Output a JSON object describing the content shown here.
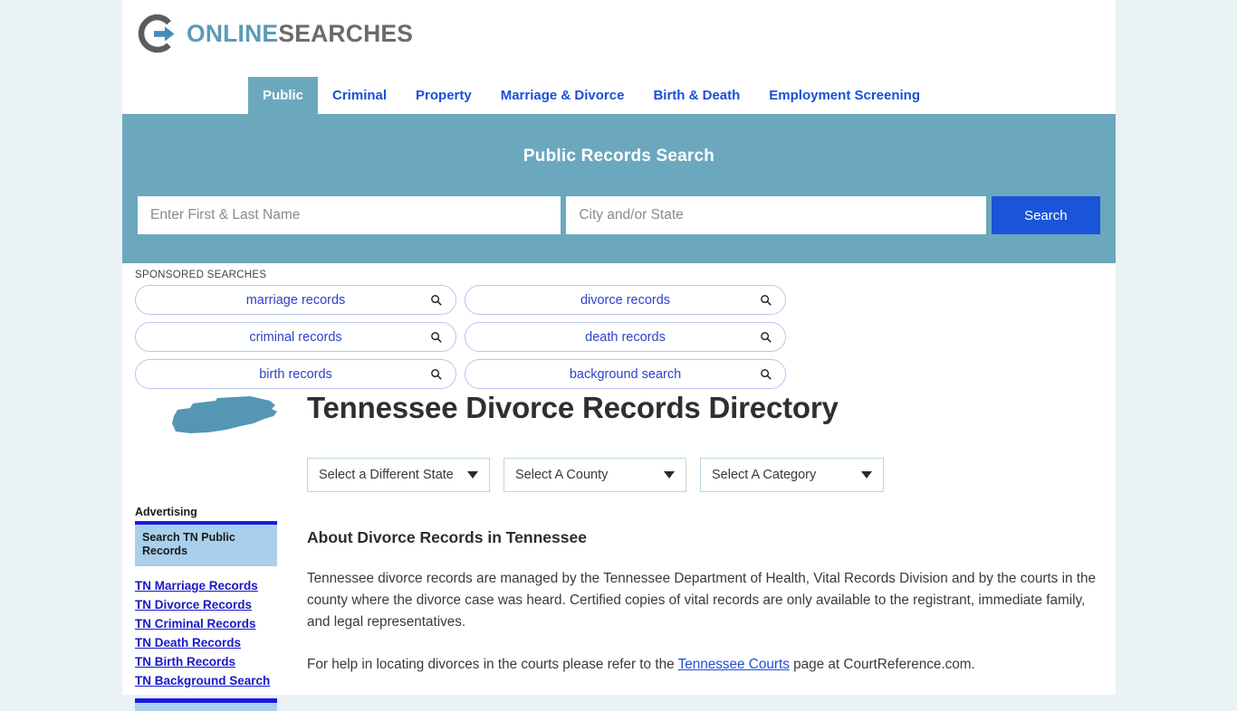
{
  "brand": {
    "logo_icon": "circle-arrow-icon",
    "name_part1": "ONLINE",
    "name_part2": "SEARCHES",
    "color_part1": "#5b9ab8",
    "color_part2": "#6b6b6b"
  },
  "nav": {
    "items": [
      {
        "label": "Public",
        "active": true
      },
      {
        "label": "Criminal",
        "active": false
      },
      {
        "label": "Property",
        "active": false
      },
      {
        "label": "Marriage & Divorce",
        "active": false
      },
      {
        "label": "Birth & Death",
        "active": false
      },
      {
        "label": "Employment Screening",
        "active": false
      }
    ],
    "active_bg": "#6ba8be",
    "link_color": "#1a4fd6"
  },
  "banner": {
    "title": "Public Records Search",
    "background": "#6ba8be",
    "name_value": "",
    "name_placeholder": "Enter First & Last Name",
    "location_value": "",
    "location_placeholder": "City and/or State",
    "search_button": "Search",
    "search_button_color": "#1a54d8"
  },
  "sponsored": {
    "label": "SPONSORED SEARCHES",
    "icon": "search-icon",
    "items": [
      {
        "label": "marriage records"
      },
      {
        "label": "divorce records"
      },
      {
        "label": "criminal records"
      },
      {
        "label": "death records"
      },
      {
        "label": "birth records"
      },
      {
        "label": "background search"
      }
    ]
  },
  "main": {
    "state_map_icon": "tennessee-map-icon",
    "state_map_color": "#5596b4",
    "title": "Tennessee Divorce Records Directory",
    "selectors": [
      {
        "label": "Select a Different State"
      },
      {
        "label": "Select A County"
      },
      {
        "label": "Select A Category"
      }
    ],
    "about_heading": "About Divorce Records in Tennessee",
    "paragraph1": "Tennessee divorce records are managed by the Tennessee Department of Health, Vital Records Division and by the courts in the county where the divorce case was heard. Certified copies of vital records are only available to the registrant, immediate family, and legal representatives.",
    "paragraph2_before": "For help in locating divorces in the courts please refer to the ",
    "paragraph2_link": "Tennessee Courts",
    "paragraph2_after": " page at CourtReference.com."
  },
  "sidebar": {
    "advertising_label": "Advertising",
    "ad_box_title": "Search TN Public Records",
    "ad_box_bg": "#a8d0ec",
    "ad_box_border": "#1a1ae0",
    "links": [
      {
        "label": "TN Marriage Records"
      },
      {
        "label": "TN Divorce Records"
      },
      {
        "label": "TN Criminal Records"
      },
      {
        "label": "TN Death Records"
      },
      {
        "label": "TN Birth Records"
      },
      {
        "label": "TN Background Search"
      }
    ]
  }
}
